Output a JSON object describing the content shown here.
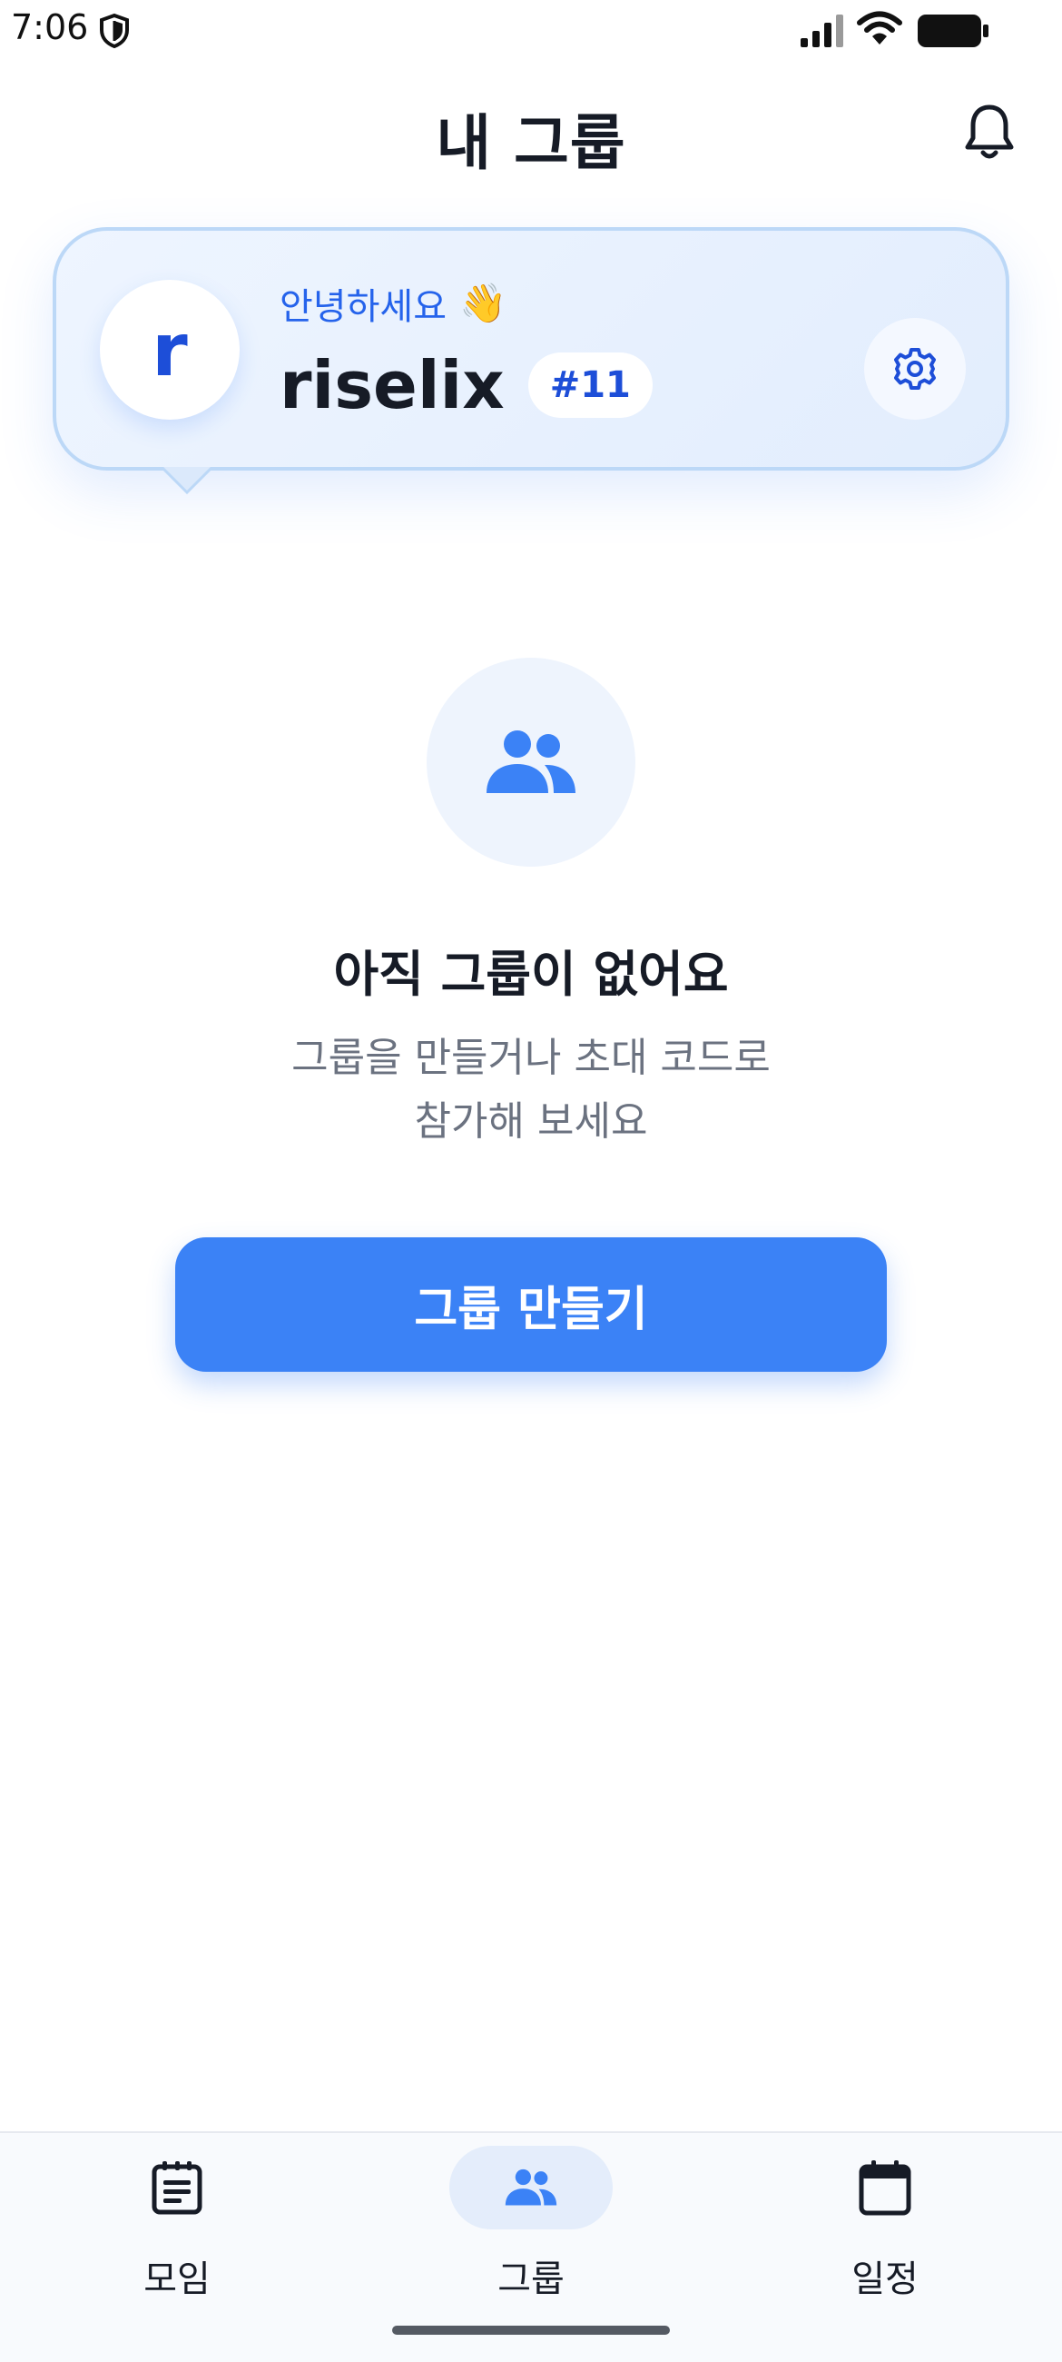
{
  "status_bar": {
    "time": "7:06",
    "icons": [
      "shield-icon",
      "signal-icon",
      "wifi-icon",
      "battery-icon"
    ]
  },
  "header": {
    "title": "내 그룹",
    "notification_icon": "bell-icon"
  },
  "profile": {
    "avatar_letter": "r",
    "greeting": "안녕하세요",
    "greeting_emoji": "👋",
    "name": "riselix",
    "tag": "#11",
    "settings_icon": "gear-icon"
  },
  "empty_state": {
    "icon": "group-icon",
    "title": "아직 그룹이 없어요",
    "description_line1": "그룹을 만들거나 초대 코드로",
    "description_line2": "참가해 보세요",
    "button_label": "그룹 만들기"
  },
  "bottom_nav": {
    "items": [
      {
        "label": "모임",
        "icon": "list-icon",
        "active": false
      },
      {
        "label": "그룹",
        "icon": "group-icon",
        "active": true
      },
      {
        "label": "일정",
        "icon": "calendar-icon",
        "active": false
      }
    ]
  },
  "colors": {
    "accent": "#3b82f6",
    "accent_dark": "#1d4ed8",
    "text": "#161b26",
    "muted": "#6b7280",
    "card_bg": "#e8f1fe"
  }
}
